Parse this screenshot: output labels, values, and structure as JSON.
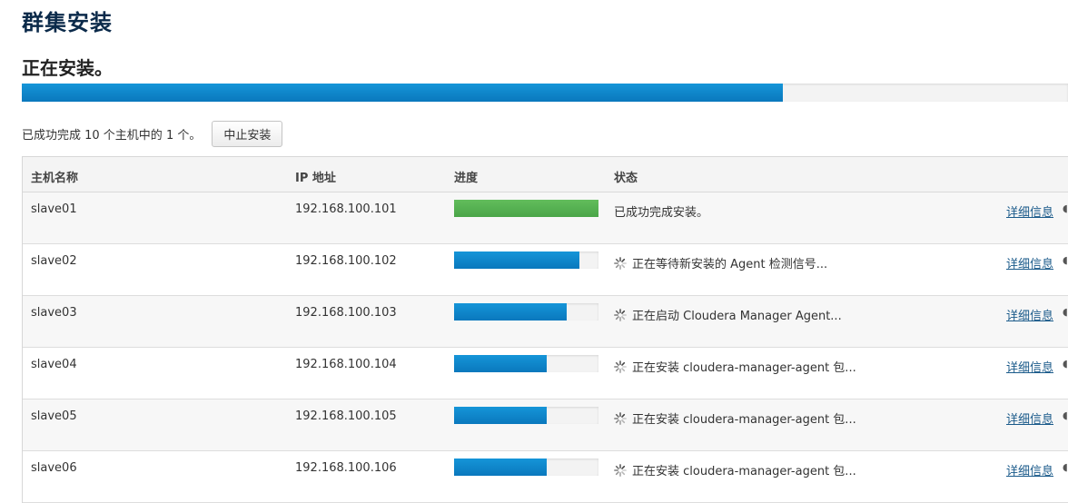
{
  "page": {
    "title": "群集安装",
    "section_title": "正在安装。",
    "overall_progress": 0.727
  },
  "summary": {
    "text": "已成功完成 10 个主机中的 1 个。",
    "abort_label": "中止安装"
  },
  "table": {
    "headers": {
      "host": "主机名称",
      "ip": "IP 地址",
      "progress": "进度",
      "status": "状态"
    },
    "rows": [
      {
        "host": "slave01",
        "ip": "192.168.100.101",
        "progress": 1.0,
        "state": "done",
        "status": "已成功完成安装。",
        "detail": "详细信息"
      },
      {
        "host": "slave02",
        "ip": "192.168.100.102",
        "progress": 0.87,
        "state": "running",
        "status": "正在等待新安装的 Agent 检测信号...",
        "detail": "详细信息"
      },
      {
        "host": "slave03",
        "ip": "192.168.100.103",
        "progress": 0.78,
        "state": "running",
        "status": "正在启动 Cloudera Manager Agent...",
        "detail": "详细信息"
      },
      {
        "host": "slave04",
        "ip": "192.168.100.104",
        "progress": 0.64,
        "state": "running",
        "status": "正在安装 cloudera-manager-agent 包...",
        "detail": "详细信息"
      },
      {
        "host": "slave05",
        "ip": "192.168.100.105",
        "progress": 0.64,
        "state": "running",
        "status": "正在安装 cloudera-manager-agent 包...",
        "detail": "详细信息"
      },
      {
        "host": "slave06",
        "ip": "192.168.100.106",
        "progress": 0.64,
        "state": "running",
        "status": "正在安装 cloudera-manager-agent 包...",
        "detail": "详细信息"
      }
    ]
  },
  "icons": {
    "spinner": "loading-spinner-icon",
    "extra": "partial-icon"
  },
  "colors": {
    "progress_blue": "#0a86ca",
    "progress_green": "#55b251",
    "title": "#0b2a4a",
    "link": "#1a5a8a"
  }
}
